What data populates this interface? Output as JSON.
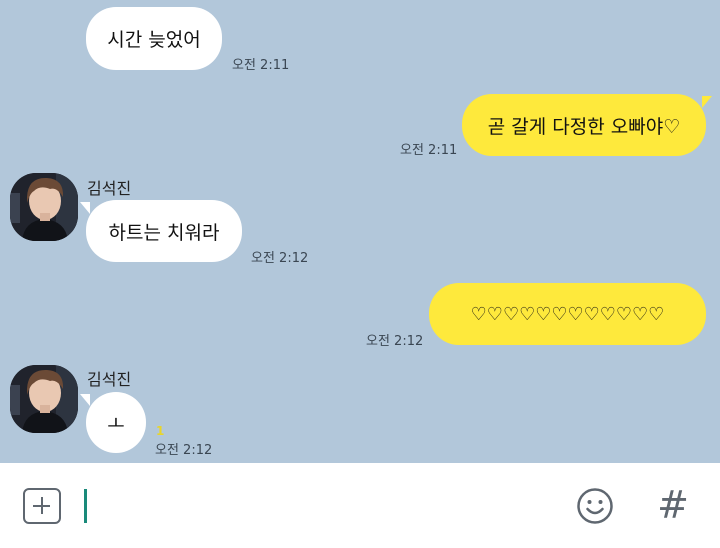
{
  "messages": [
    {
      "text": "시간 늦었어",
      "time": "오전 2:11"
    },
    {
      "text": "곧 갈게 다정한 오빠야♡",
      "time": "오전 2:11"
    },
    {
      "sender": "김석진",
      "text": "하트는 치워라",
      "time": "오전 2:12"
    },
    {
      "text": "♡♡♡♡♡♡♡♡♡♡♡♡",
      "time": "오전 2:12"
    },
    {
      "sender": "김석진",
      "text": "ㅗ",
      "time": "오전 2:12",
      "unread": "1"
    }
  ],
  "input": {
    "value": "",
    "placeholder": ""
  },
  "icons": {
    "attach": "plus-icon",
    "emoji": "smiley-icon",
    "hashtag": "hash-icon",
    "hash_glyph": "#"
  },
  "colors": {
    "background": "#b2c7da",
    "incoming": "#ffffff",
    "outgoing": "#fee93c",
    "unread": "#e8d52b",
    "cursor": "#1a8a7a"
  }
}
